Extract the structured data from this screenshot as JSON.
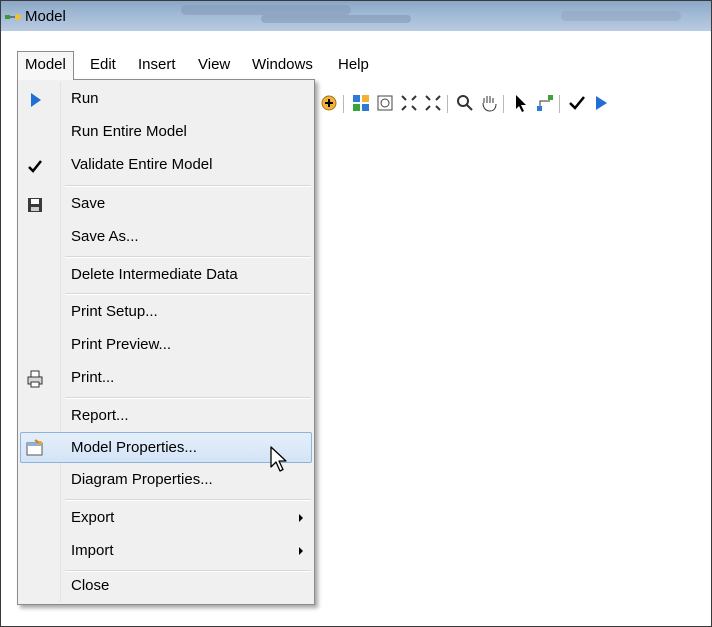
{
  "window": {
    "title": "Model"
  },
  "menubar": {
    "items": [
      "Model",
      "Edit",
      "Insert",
      "View",
      "Windows",
      "Help"
    ]
  },
  "model_menu": {
    "items": [
      {
        "label": "Run",
        "icon": "run-triangle-icon"
      },
      {
        "label": "Run Entire Model",
        "icon": ""
      },
      {
        "label": "Validate Entire Model",
        "icon": "checkmark-icon"
      },
      {
        "label": "Save",
        "icon": "floppy-disk-icon"
      },
      {
        "label": "Save As...",
        "icon": ""
      },
      {
        "label": "Delete Intermediate Data",
        "icon": ""
      },
      {
        "label": "Print Setup...",
        "icon": ""
      },
      {
        "label": "Print Preview...",
        "icon": ""
      },
      {
        "label": "Print...",
        "icon": "printer-icon"
      },
      {
        "label": "Report...",
        "icon": ""
      },
      {
        "label": "Model Properties...",
        "icon": "properties-icon",
        "highlighted": true
      },
      {
        "label": "Diagram Properties...",
        "icon": ""
      },
      {
        "label": "Export",
        "icon": "",
        "submenu": true
      },
      {
        "label": "Import",
        "icon": "",
        "submenu": true
      },
      {
        "label": "Close",
        "icon": ""
      }
    ]
  },
  "colors": {
    "highlight_bg": "#d3e4f7",
    "highlight_border": "#8fb2db",
    "run_blue": "#1f6fd6",
    "menu_bg": "#f0f0f0"
  }
}
